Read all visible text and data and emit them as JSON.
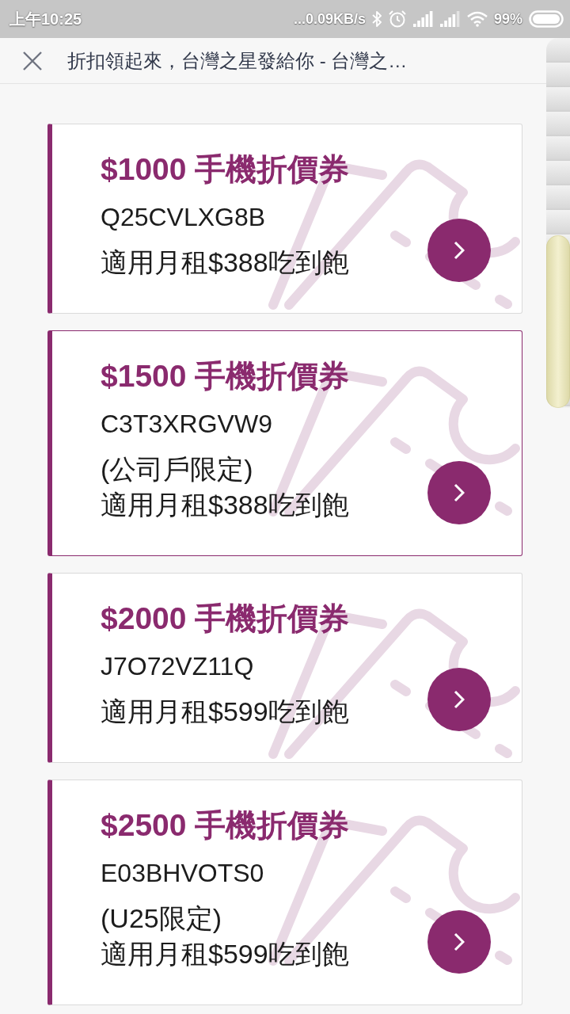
{
  "status_bar": {
    "time": "上午10:25",
    "network_speed": "...0.09KB/s",
    "battery": "99%"
  },
  "toolbar": {
    "title": "折扣領起來，台灣之星發給你 - 台灣之…"
  },
  "coupons": [
    {
      "title": "$1000 手機折價券",
      "code": "Q25CVLXG8B",
      "lines": [
        "適用月租$388吃到飽"
      ],
      "selected": false
    },
    {
      "title": "$1500 手機折價券",
      "code": "C3T3XRGVW9",
      "lines": [
        "(公司戶限定)",
        "適用月租$388吃到飽"
      ],
      "selected": true
    },
    {
      "title": "$2000 手機折價券",
      "code": "J7O72VZ11Q",
      "lines": [
        "適用月租$599吃到飽"
      ],
      "selected": false
    },
    {
      "title": "$2500 手機折價券",
      "code": "E03BHVOTS0",
      "lines": [
        "(U25限定)",
        "適用月租$599吃到飽"
      ],
      "selected": false
    }
  ]
}
